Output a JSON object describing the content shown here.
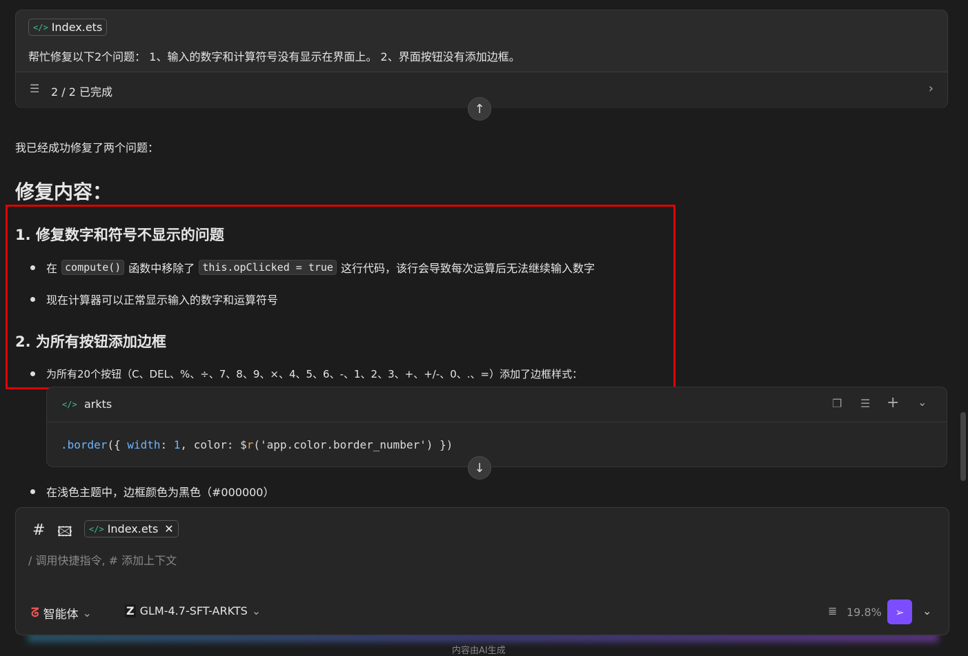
{
  "task_card": {
    "file_chip": "Index.ets",
    "prompt": "帮忙修复以下2个问题： 1、输入的数字和计算符号没有显示在界面上。 2、界面按钮没有添加边框。",
    "progress_label": "2 / 2 已完成"
  },
  "response": {
    "intro": "我已经成功修复了两个问题：",
    "heading": "修复内容：",
    "section1": {
      "title": "1. 修复数字和符号不显示的问题",
      "b1_pre": "在",
      "b1_code1": "compute()",
      "b1_mid": "函数中移除了",
      "b1_code2": "this.opClicked = true",
      "b1_post": "这行代码，该行会导致每次运算后无法继续输入数字",
      "b2": "现在计算器可以正常显示输入的数字和运算符号"
    },
    "section2": {
      "title": "2. 为所有按钮添加边框",
      "b1": "为所有20个按钮（C、DEL、%、÷、7、8、9、×、4、5、6、-、1、2、3、+、+/-、0、.、=）添加了边框样式：",
      "b2": "在浅色主题中，边框颜色为黑色（#000000）"
    },
    "code": {
      "lang": "arkts",
      "t1": ".border",
      "t2": "({ ",
      "t3": "width",
      "t4": ": ",
      "t5": "1",
      "t6": ", color: $",
      "t7": "r",
      "t8": "('app.color.border_number') })"
    }
  },
  "composer": {
    "file_chip": "Index.ets",
    "placeholder": "/ 调用快捷指令, # 添加上下文",
    "mode": "智能体",
    "model": "GLM-4.7-SFT-ARKTS",
    "usage": "19.8%"
  },
  "footer": "内容由AI生成",
  "colors": {
    "accent": "#7c4dff",
    "highlight": "#e00000"
  }
}
